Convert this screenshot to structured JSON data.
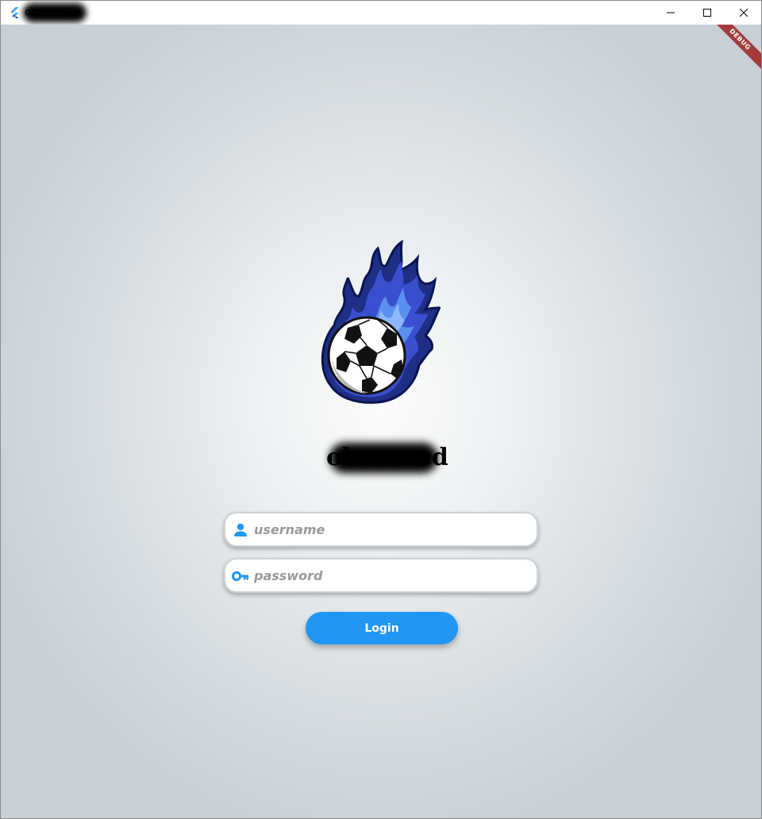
{
  "window": {
    "title": "obscured",
    "controls": {
      "minimize_icon": "minimize-icon",
      "maximize_icon": "maximize-icon",
      "close_icon": "close-icon"
    }
  },
  "debug_banner": {
    "label": "DEBUG",
    "color": "#a33b3b"
  },
  "logo": {
    "icon": "soccer-ball-flame-icon"
  },
  "app_title": {
    "text": "obscured"
  },
  "form": {
    "username": {
      "value": "",
      "placeholder": "username",
      "icon": "person-icon"
    },
    "password": {
      "value": "",
      "placeholder": "password",
      "icon": "key-icon"
    },
    "login_button": {
      "label": "Login"
    }
  },
  "colors": {
    "accent": "#2196f3",
    "background_center": "#fbfcfc",
    "background_edge": "#c8d0d6"
  }
}
